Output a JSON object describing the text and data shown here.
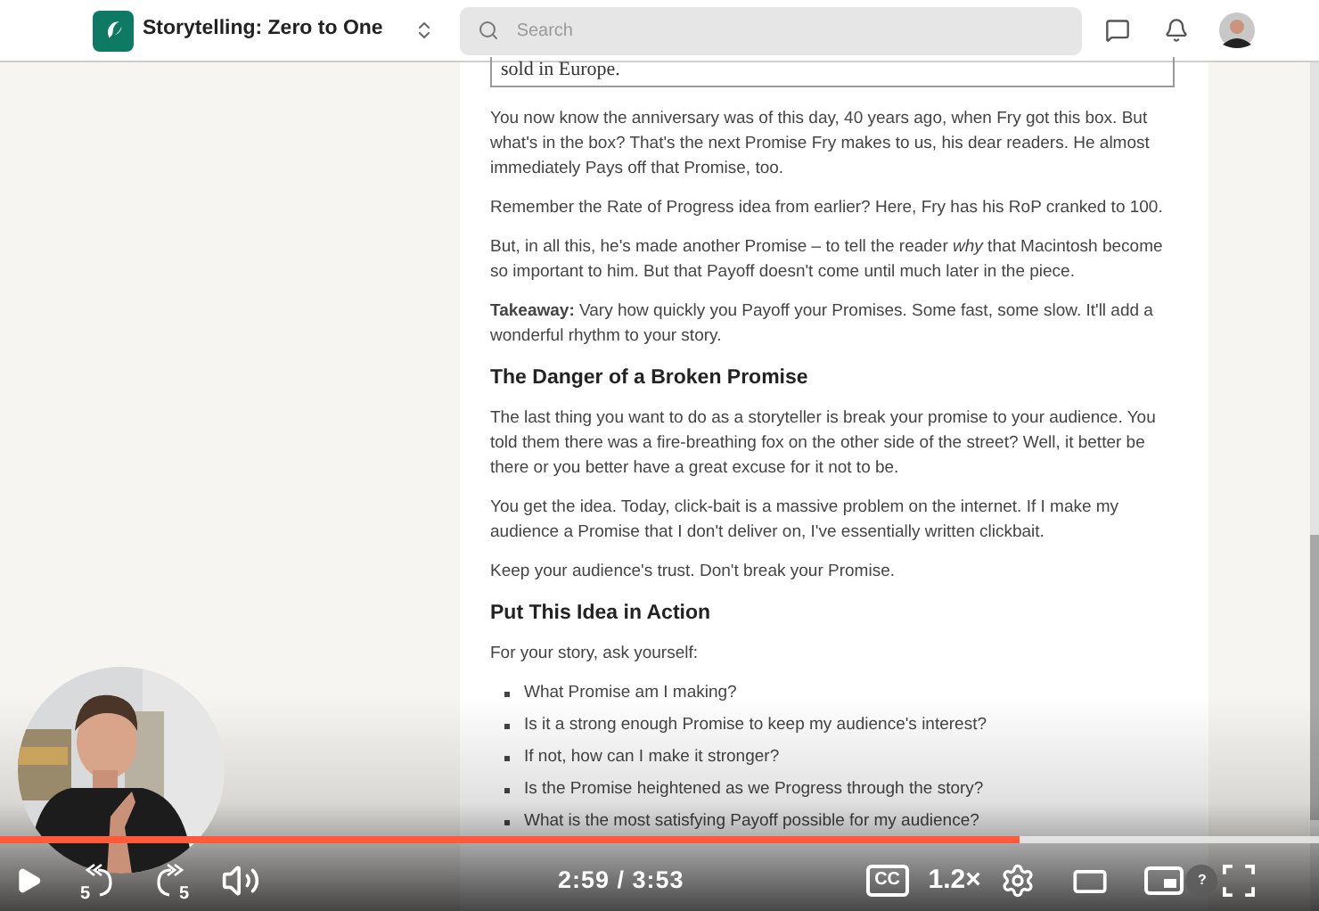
{
  "header": {
    "course_title": "Storytelling: Zero to One",
    "search": {
      "placeholder": "Search"
    }
  },
  "article": {
    "quote_tail": "sold in Europe.",
    "blocks": [
      {
        "kind": "paragraph",
        "text": "You now know the anniversary was of this day, 40 years ago, when Fry got this box. But what's in the box? That's the next Promise Fry makes to us, his dear readers. He almost immediately Pays off that Promise, too."
      },
      {
        "kind": "paragraph",
        "text": "Remember the Rate of Progress idea from earlier? Here, Fry has his RoP cranked to 100."
      },
      {
        "kind": "paragraph",
        "text": "But, in all this, he's made another Promise – to tell the reader *why* that Macintosh become so important to him. But that Payoff doesn't come until much later in the piece."
      },
      {
        "kind": "paragraph",
        "text": "**Takeaway:** Vary how quickly you Payoff your Promises. Some fast, some slow. It'll add a wonderful rhythm to your story."
      },
      {
        "kind": "heading",
        "text": "The Danger of a Broken Promise"
      },
      {
        "kind": "paragraph",
        "text": "The last thing you want to do as a storyteller is break your promise to your audience. You told them there was a fire-breathing fox on the other side of the street? Well, it better be there or you better have a great excuse for it not to be."
      },
      {
        "kind": "paragraph",
        "text": "You get the idea. Today, click-bait is a massive problem on the internet. If I make my audience a Promise that I don't deliver on, I've essentially written clickbait."
      },
      {
        "kind": "paragraph",
        "text": "Keep your audience's trust. Don't break your Promise."
      },
      {
        "kind": "heading",
        "text": "Put This Idea in Action"
      },
      {
        "kind": "paragraph",
        "text": "For your story, ask yourself:"
      },
      {
        "kind": "bullet",
        "text": "What Promise am I making?"
      },
      {
        "kind": "bullet",
        "text": "Is it a strong enough Promise to keep my audience's interest?"
      },
      {
        "kind": "bullet",
        "text": "If not, how can I make it stronger?"
      },
      {
        "kind": "bullet",
        "text": "Is the Promise heightened as we Progress through the story?"
      },
      {
        "kind": "bullet",
        "text": "What is the most satisfying Payoff possible for my audience?"
      }
    ]
  },
  "player": {
    "progress": {
      "level": 0.773
    },
    "playing": false,
    "seek_back_label": "5",
    "seek_forward_label": "5",
    "time": "2:59 / 3:53",
    "captions_label": "CC",
    "speed": "1.2×",
    "help_label": "?"
  }
}
